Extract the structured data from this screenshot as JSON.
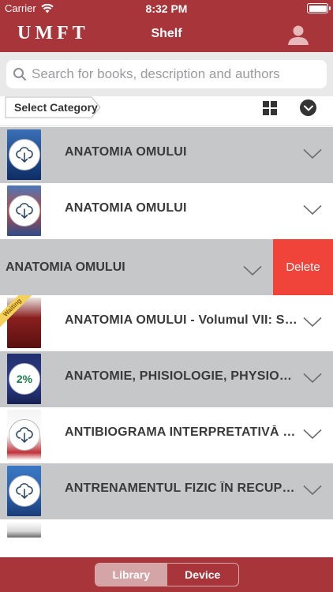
{
  "status": {
    "carrier": "Carrier",
    "time": "8:32 PM"
  },
  "nav": {
    "logo": "UMFT",
    "title": "Shelf",
    "profile_icon": "person-icon"
  },
  "search": {
    "placeholder": "Search for books, description and authors"
  },
  "category": {
    "label": "Select Category"
  },
  "books": [
    {
      "title": "ANATOMIA OMULUI",
      "state": "download",
      "background": "gray"
    },
    {
      "title": "ANATOMIA OMULUI",
      "state": "download",
      "background": "white"
    },
    {
      "title": "ANATOMIA OMULUI",
      "state": "swiped",
      "background": "gray",
      "delete_label": "Delete"
    },
    {
      "title": "ANATOMIA OMULUI -  Volumul VII: Sistemul nervos",
      "state": "waiting",
      "ribbon": "Waiting",
      "background": "white"
    },
    {
      "title": "ANATOMIE, PHISIOLOGIE, PHYSIOPATHOLOGIE",
      "state": "progress",
      "progress_label": "2%",
      "progress_fraction": 0.02,
      "background": "gray"
    },
    {
      "title": "ANTIBIOGRAMA INTERPRETATIVĂ ȘI REZISTENȚA",
      "state": "download",
      "background": "white"
    },
    {
      "title": "ANTRENAMENTUL FIZIC ÎN RECUPERARE",
      "state": "download",
      "background": "gray"
    }
  ],
  "tabs": {
    "library": "Library",
    "device": "Device",
    "active": "library"
  },
  "colors": {
    "brand": "#a8353a",
    "row_gray": "#c5c7c9",
    "delete": "#f0433a",
    "progress": "#1b7d4a"
  }
}
